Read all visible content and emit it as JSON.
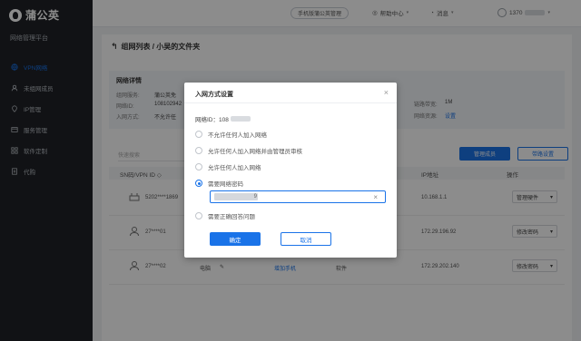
{
  "brand": {
    "name": "蒲公英",
    "platform": "网络管理平台"
  },
  "nav": [
    {
      "label": "VPN网络",
      "icon": "globe-icon"
    },
    {
      "label": "未组网成员",
      "icon": "user-icon"
    },
    {
      "label": "IP管理",
      "icon": "ip-icon"
    },
    {
      "label": "服务管理",
      "icon": "service-icon"
    },
    {
      "label": "软件定制",
      "icon": "grid-icon"
    },
    {
      "label": "代购",
      "icon": "document-icon"
    }
  ],
  "topbar": {
    "mobile_btn": "手机版蒲公英管理",
    "help": "帮助中心",
    "messages": "消息",
    "account_prefix": "1370"
  },
  "page": {
    "breadcrumb": "组网列表 / 小吴的文件夹"
  },
  "info": {
    "title": "网络详情",
    "service_label": "组网服务:",
    "service_value": "蒲公英免",
    "network_id_label": "网络ID:",
    "network_id_value": "108102942",
    "join_label": "入网方式:",
    "join_value": "不允许任",
    "bandwidth_label": "链路带宽:",
    "bandwidth_value": "1M",
    "resource_label": "网络资源:",
    "resource_value": "设置"
  },
  "toolbar": {
    "search_placeholder": "快速搜索",
    "manage_members": "管理成员",
    "bulk_settings": "带路设置"
  },
  "table": {
    "headers": {
      "sn": "SN码/VPN ID",
      "ip": "IP地址",
      "action": "操作"
    },
    "rows": [
      {
        "sn": "5202****1869",
        "ip": "10.168.1.1",
        "action": "管理硬件"
      },
      {
        "sn": "27****01",
        "ip": "172.29.196.92",
        "action": "修改密码"
      },
      {
        "sn": "27****02",
        "type": "电脑",
        "device": "增加手机",
        "software": "软件",
        "ip": "172.29.202.140",
        "action": "修改密码"
      }
    ]
  },
  "modal": {
    "title": "入网方式设置",
    "network_id_prefix": "网络ID：108",
    "options": [
      "不允许任何人加入网络",
      "允许任何人加入网络并由管理员审核",
      "允许任何人加入网络",
      "需要网络密码",
      "需要正确回答问题"
    ],
    "selected_index": 3,
    "password_tail": "9",
    "ok": "确定",
    "cancel": "取消"
  }
}
